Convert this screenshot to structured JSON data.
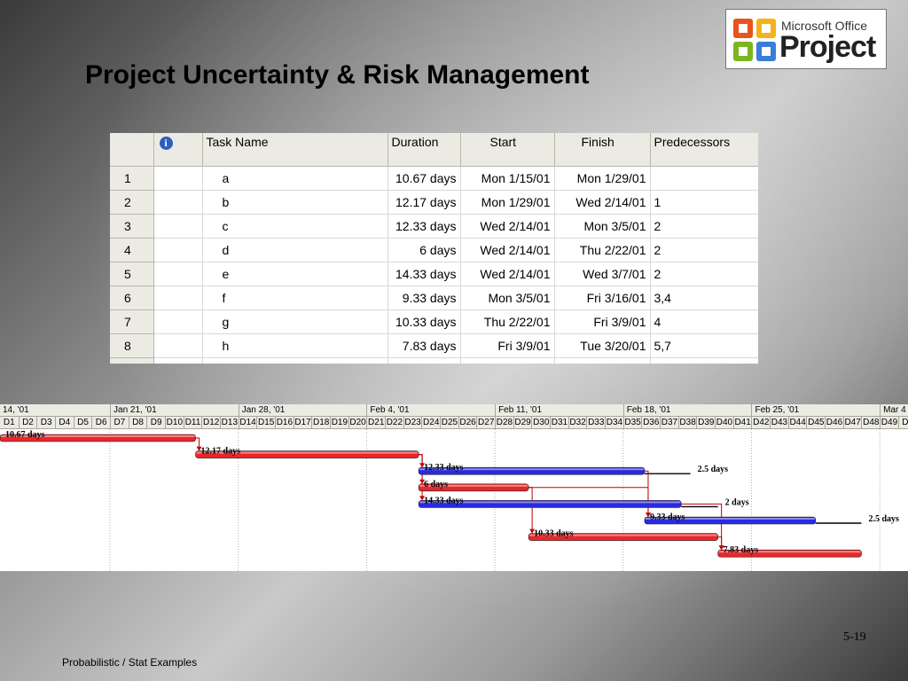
{
  "slide": {
    "title": "Project Uncertainty & Risk Management",
    "footer_left": "Probabilistic / Stat Examples",
    "page_number": "5-19"
  },
  "logo": {
    "line1": "Microsoft Office",
    "line2": "Project",
    "colors": [
      "#e8541c",
      "#f5b21a",
      "#7bb51f",
      "#3b7dd8"
    ]
  },
  "table": {
    "columns": [
      "",
      "",
      "Task Name",
      "Duration",
      "Start",
      "Finish",
      "Predecessors"
    ],
    "info_icon": "i",
    "rows": [
      {
        "id": "1",
        "name": "a",
        "duration": "10.67 days",
        "start": "Mon 1/15/01",
        "finish": "Mon 1/29/01",
        "pred": ""
      },
      {
        "id": "2",
        "name": "b",
        "duration": "12.17 days",
        "start": "Mon 1/29/01",
        "finish": "Wed 2/14/01",
        "pred": "1"
      },
      {
        "id": "3",
        "name": "c",
        "duration": "12.33 days",
        "start": "Wed 2/14/01",
        "finish": "Mon 3/5/01",
        "pred": "2"
      },
      {
        "id": "4",
        "name": "d",
        "duration": "6 days",
        "start": "Wed 2/14/01",
        "finish": "Thu 2/22/01",
        "pred": "2"
      },
      {
        "id": "5",
        "name": "e",
        "duration": "14.33 days",
        "start": "Wed 2/14/01",
        "finish": "Wed 3/7/01",
        "pred": "2"
      },
      {
        "id": "6",
        "name": "f",
        "duration": "9.33 days",
        "start": "Mon 3/5/01",
        "finish": "Fri 3/16/01",
        "pred": "3,4"
      },
      {
        "id": "7",
        "name": "g",
        "duration": "10.33 days",
        "start": "Thu 2/22/01",
        "finish": "Fri 3/9/01",
        "pred": "4"
      },
      {
        "id": "8",
        "name": "h",
        "duration": "7.83 days",
        "start": "Fri 3/9/01",
        "finish": "Tue 3/20/01",
        "pred": "5,7"
      }
    ]
  },
  "gantt": {
    "weeks": [
      "14, '01",
      "Jan 21, '01",
      "Jan 28, '01",
      "Feb 4, '01",
      "Feb 11, '01",
      "Feb 18, '01",
      "Feb 25, '01",
      "Mar 4"
    ],
    "days": [
      "D1",
      "D2",
      "D3",
      "D4",
      "D5",
      "D6",
      "D7",
      "D8",
      "D9",
      "D10",
      "D11",
      "D12",
      "D13",
      "D14",
      "D15",
      "D16",
      "D17",
      "D18",
      "D19",
      "D20",
      "D21",
      "D22",
      "D23",
      "D24",
      "D25",
      "D26",
      "D27",
      "D28",
      "D29",
      "D30",
      "D31",
      "D32",
      "D33",
      "D34",
      "D35",
      "D36",
      "D37",
      "D38",
      "D39",
      "D40",
      "D41",
      "D42",
      "D43",
      "D44",
      "D45",
      "D46",
      "D47",
      "D48",
      "D49",
      "D5"
    ],
    "colors": {
      "critical": "#e8272b",
      "noncritical": "#2a2ae0",
      "link": "#c00000",
      "slack": "#000000"
    },
    "bars": [
      {
        "task": "a",
        "label": "10.67 days",
        "start_day": 1,
        "duration_days": 10.67,
        "critical": true
      },
      {
        "task": "b",
        "label": "12.17 days",
        "start_day": 11.67,
        "duration_days": 12.17,
        "critical": true
      },
      {
        "task": "c",
        "label": "12.33 days",
        "start_day": 23.84,
        "duration_days": 12.33,
        "critical": false,
        "slack_label": "2.5 days"
      },
      {
        "task": "d",
        "label": "6 days",
        "start_day": 23.84,
        "duration_days": 6,
        "critical": true
      },
      {
        "task": "e",
        "label": "14.33 days",
        "start_day": 23.84,
        "duration_days": 14.33,
        "critical": false,
        "slack_label": "2 days"
      },
      {
        "task": "f",
        "label": "9.33 days",
        "start_day": 36.17,
        "duration_days": 9.33,
        "critical": false,
        "slack_label": "2.5 days"
      },
      {
        "task": "g",
        "label": "10.33 days",
        "start_day": 29.84,
        "duration_days": 10.33,
        "critical": true
      },
      {
        "task": "h",
        "label": "7.83 days",
        "start_day": 40.17,
        "duration_days": 7.83,
        "critical": true
      }
    ],
    "links": [
      {
        "from": "a",
        "to": "b"
      },
      {
        "from": "b",
        "to": "c"
      },
      {
        "from": "b",
        "to": "d"
      },
      {
        "from": "b",
        "to": "e"
      },
      {
        "from": "c",
        "to": "f"
      },
      {
        "from": "d",
        "to": "f"
      },
      {
        "from": "d",
        "to": "g"
      },
      {
        "from": "e",
        "to": "h"
      },
      {
        "from": "g",
        "to": "h"
      }
    ]
  }
}
